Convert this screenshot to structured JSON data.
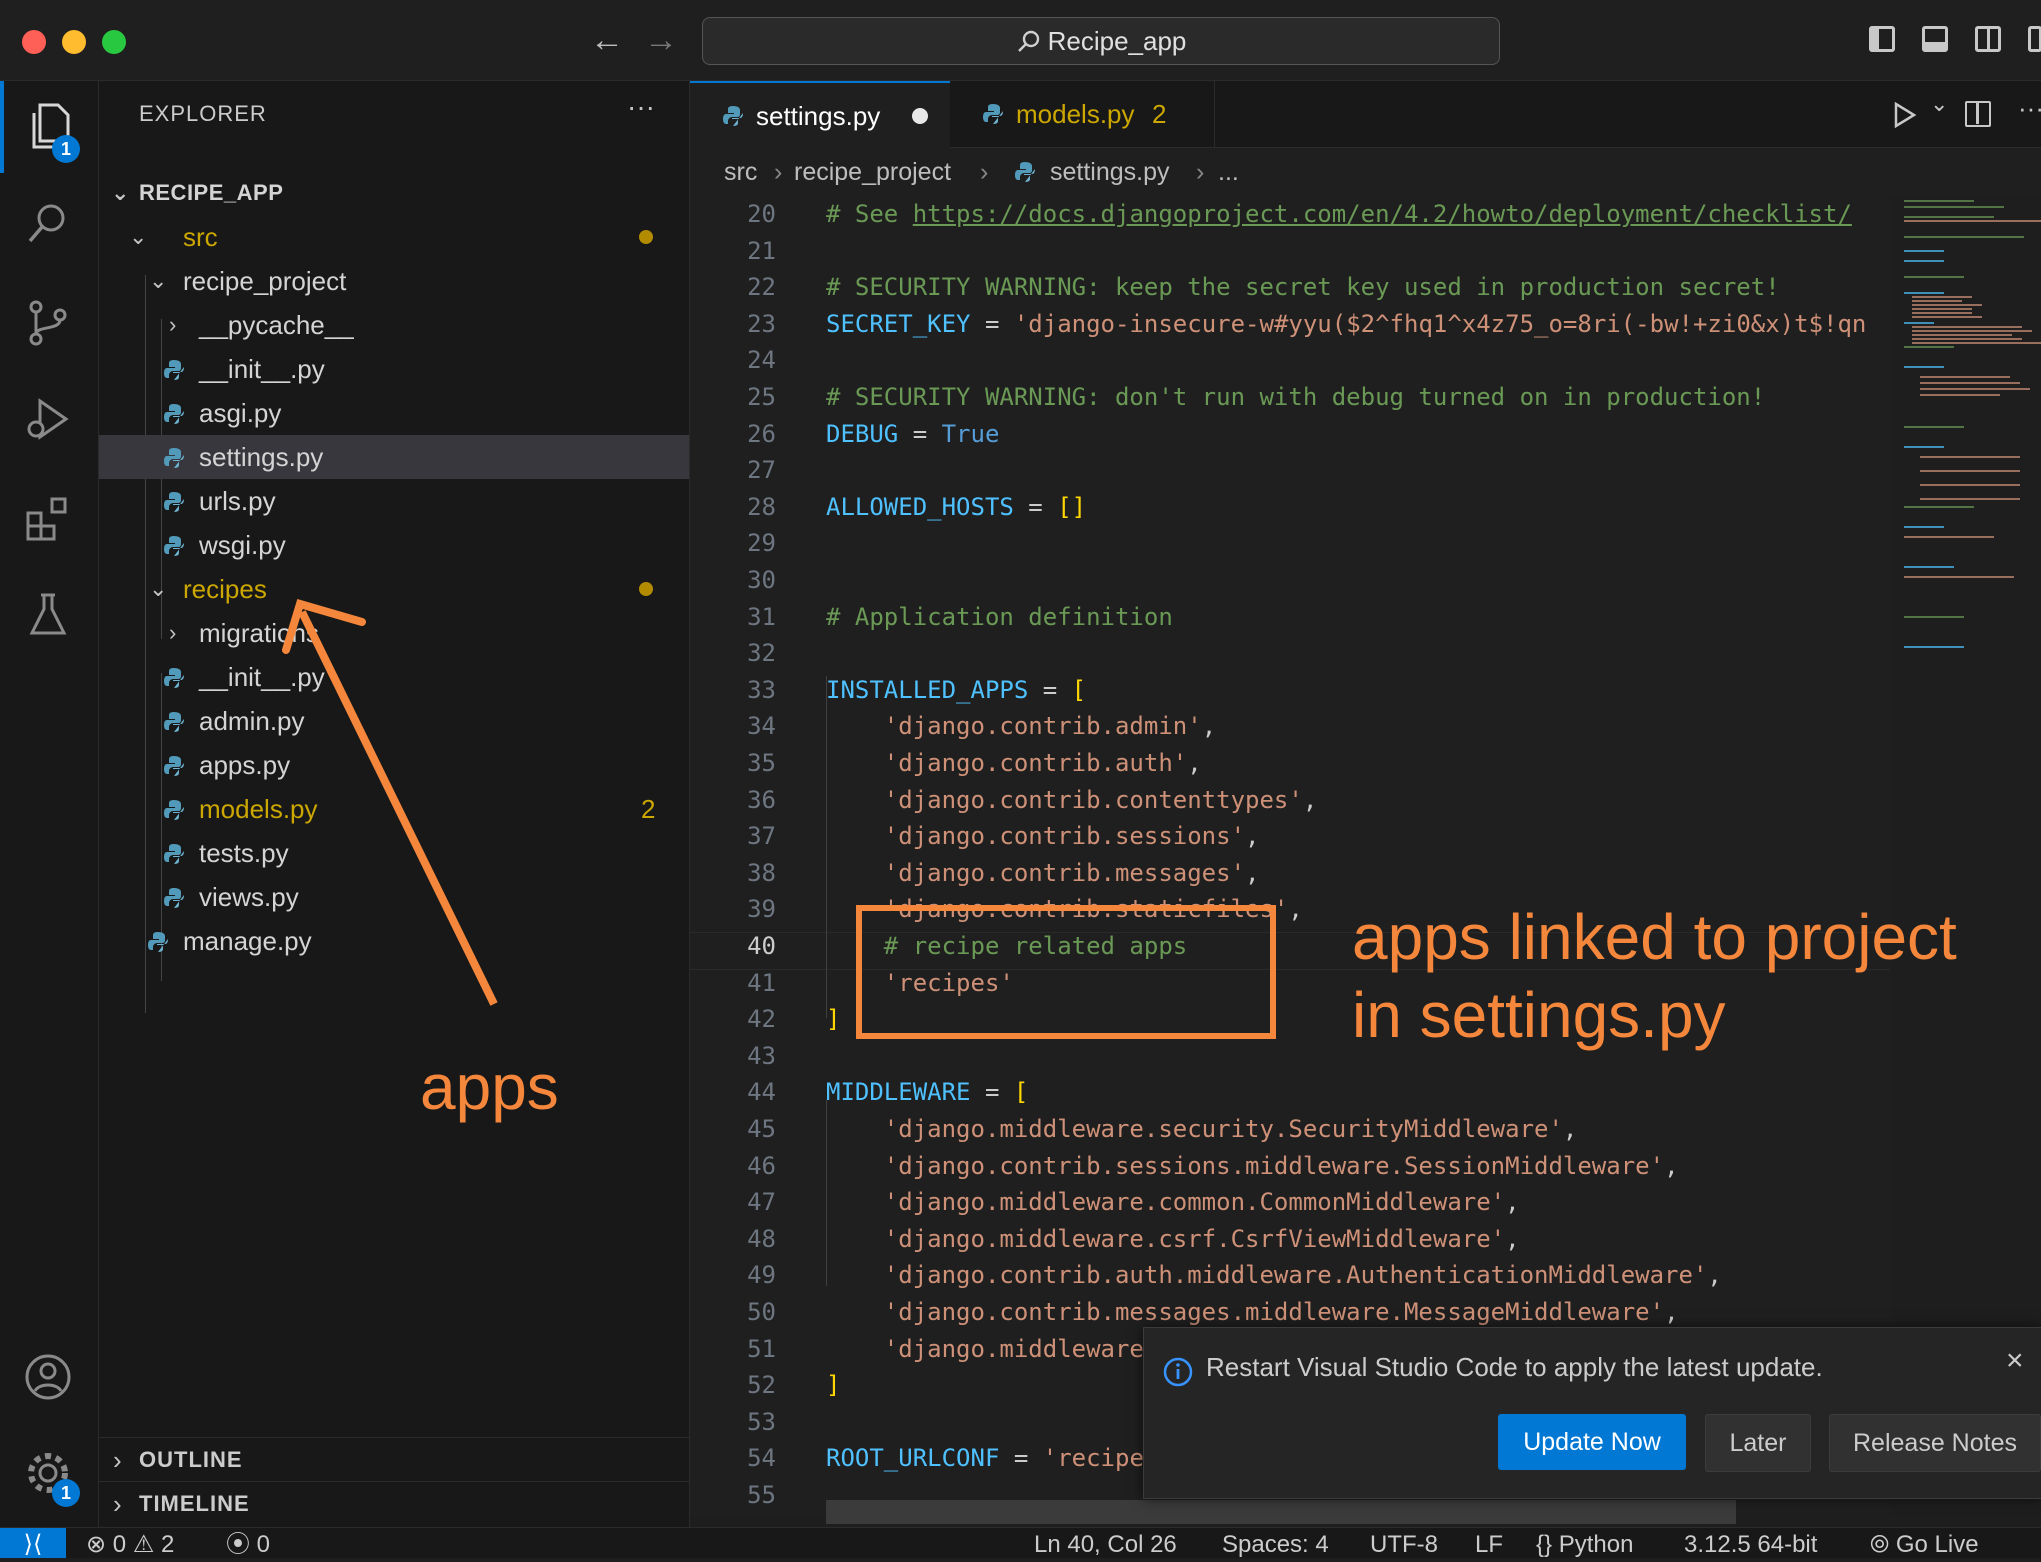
{
  "titlebar": {
    "search_label": "Recipe_app"
  },
  "activity": {
    "explorer_badge": "1",
    "settings_badge": "1"
  },
  "sidebar": {
    "title": "EXPLORER",
    "more": "···",
    "root": "RECIPE_APP",
    "items": [
      {
        "label": "src"
      },
      {
        "label": "recipe_project"
      },
      {
        "label": "__pycache__"
      },
      {
        "label": "__init__.py"
      },
      {
        "label": "asgi.py"
      },
      {
        "label": "settings.py"
      },
      {
        "label": "urls.py"
      },
      {
        "label": "wsgi.py"
      },
      {
        "label": "recipes"
      },
      {
        "label": "migrations"
      },
      {
        "label": "__init__.py"
      },
      {
        "label": "admin.py"
      },
      {
        "label": "apps.py"
      },
      {
        "label": "models.py",
        "badge": "2"
      },
      {
        "label": "tests.py"
      },
      {
        "label": "views.py"
      },
      {
        "label": "manage.py"
      }
    ],
    "outline": "OUTLINE",
    "timeline": "TIMELINE"
  },
  "tabs": [
    {
      "label": "settings.py",
      "active": true,
      "modified": true
    },
    {
      "label": "models.py",
      "badge": "2"
    }
  ],
  "breadcrumb": {
    "p1": "src",
    "p2": "recipe_project",
    "p3": "settings.py",
    "p4": "..."
  },
  "code": {
    "current_line": 40,
    "lines": [
      {
        "n": "20",
        "text": "# See https://docs.djangoproject.com/en/4.2/howto/deployment/checklist/"
      },
      {
        "n": "21",
        "text": ""
      },
      {
        "n": "22",
        "text": "# SECURITY WARNING: keep the secret key used in production secret!"
      },
      {
        "n": "23",
        "text": "SECRET_KEY = 'django-insecure-w#yyu($2^fhq1^x4z75_o=8ri(-bw!+zi0&x)t$!qn"
      },
      {
        "n": "24",
        "text": ""
      },
      {
        "n": "25",
        "text": "# SECURITY WARNING: don't run with debug turned on in production!"
      },
      {
        "n": "26",
        "text": "DEBUG = True"
      },
      {
        "n": "27",
        "text": ""
      },
      {
        "n": "28",
        "text": "ALLOWED_HOSTS = []"
      },
      {
        "n": "29",
        "text": ""
      },
      {
        "n": "30",
        "text": ""
      },
      {
        "n": "31",
        "text": "# Application definition"
      },
      {
        "n": "32",
        "text": ""
      },
      {
        "n": "33",
        "text": "INSTALLED_APPS = ["
      },
      {
        "n": "34",
        "text": "    'django.contrib.admin',"
      },
      {
        "n": "35",
        "text": "    'django.contrib.auth',"
      },
      {
        "n": "36",
        "text": "    'django.contrib.contenttypes',"
      },
      {
        "n": "37",
        "text": "    'django.contrib.sessions',"
      },
      {
        "n": "38",
        "text": "    'django.contrib.messages',"
      },
      {
        "n": "39",
        "text": "    'django.contrib.staticfiles',"
      },
      {
        "n": "40",
        "text": "    # recipe related apps"
      },
      {
        "n": "41",
        "text": "    'recipes'"
      },
      {
        "n": "42",
        "text": "]"
      },
      {
        "n": "43",
        "text": ""
      },
      {
        "n": "44",
        "text": "MIDDLEWARE = ["
      },
      {
        "n": "45",
        "text": "    'django.middleware.security.SecurityMiddleware',"
      },
      {
        "n": "46",
        "text": "    'django.contrib.sessions.middleware.SessionMiddleware',"
      },
      {
        "n": "47",
        "text": "    'django.middleware.common.CommonMiddleware',"
      },
      {
        "n": "48",
        "text": "    'django.middleware.csrf.CsrfViewMiddleware',"
      },
      {
        "n": "49",
        "text": "    'django.contrib.auth.middleware.AuthenticationMiddleware',"
      },
      {
        "n": "50",
        "text": "    'django.contrib.messages.middleware.MessageMiddleware',"
      },
      {
        "n": "51",
        "text": "    'django.middleware"
      },
      {
        "n": "52",
        "text": "]"
      },
      {
        "n": "53",
        "text": ""
      },
      {
        "n": "54",
        "text": "ROOT_URLCONF = 'recipe"
      },
      {
        "n": "55",
        "text": ""
      }
    ]
  },
  "annotations": {
    "apps_label": "apps",
    "linked_line1": "apps linked to project",
    "linked_line2": "in settings.py",
    "color": "#f5873c"
  },
  "notification": {
    "message": "Restart Visual Studio Code to apply the latest update.",
    "primary": "Update Now",
    "later": "Later",
    "notes": "Release Notes"
  },
  "status": {
    "errors": "0",
    "warnings": "2",
    "ports": "0",
    "position": "Ln 40, Col 26",
    "spaces": "Spaces: 4",
    "encoding": "UTF-8",
    "eol": "LF",
    "language": "Python",
    "interpreter": "3.12.5 64-bit",
    "golive": "Go Live"
  }
}
